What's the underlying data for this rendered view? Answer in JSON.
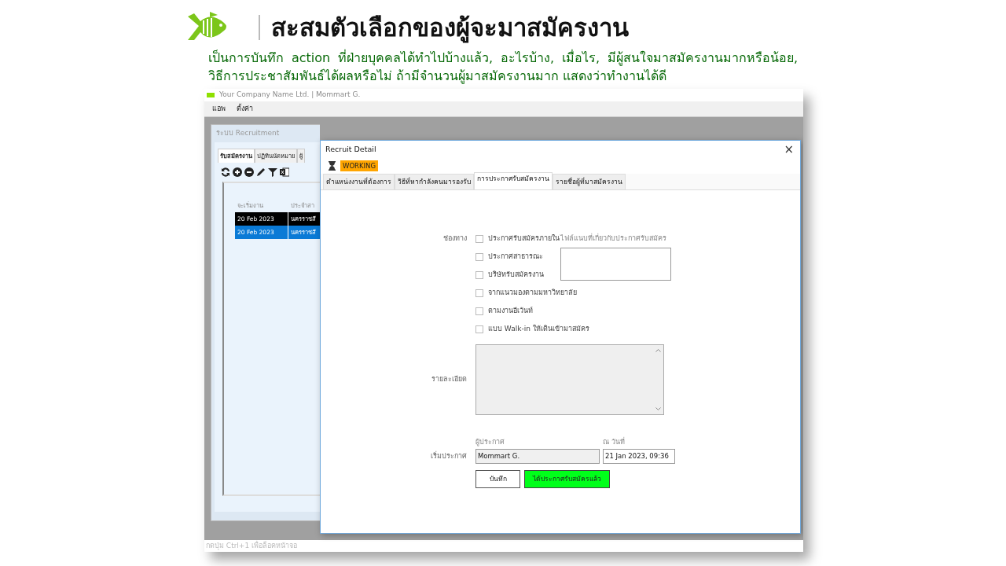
{
  "slide": {
    "title": "สะสมตัวเลือกของผู้จะมาสมัครงาน",
    "description": "เป็นการบันทึก action ที่ฝ่ายบุคคลได้ทำไปบ้างแล้ว, อะไรบ้าง, เมื่อไร, มีผู้สนใจมาสมัครงานมากหรือน้อย, วิธีการประชาสัมพันธ์ได้ผลหรือไม่ ถ้ามีจำนวนผู้มาสมัครงานมาก แสดงว่าทำงานได้ดี"
  },
  "app": {
    "window_title": "Your Company Name Ltd. | Mommart G.",
    "menu": [
      "แอพ",
      "ตั้งค่า"
    ],
    "status_bar": "กดปุ่ม Ctrl+1 เพื่อล็อคหน้าจอ"
  },
  "main_window": {
    "title": "ระบบ Recruitment",
    "tabs": [
      {
        "label": "รับสมัครงาน",
        "selected": true
      },
      {
        "label": "ปฏิทินนัดหมาย",
        "selected": false
      },
      {
        "label": "ผู้",
        "selected": false
      }
    ],
    "table": {
      "columns": [
        "จะเริ่มงาน",
        "ประจำสา"
      ],
      "rows": [
        {
          "cells": [
            "20 Feb 2023",
            "นครราชสี"
          ],
          "current": true,
          "selected": false
        },
        {
          "cells": [
            "20 Feb 2023",
            "นครราชสี"
          ],
          "current": false,
          "selected": true
        }
      ]
    }
  },
  "dialog": {
    "title": "Recruit Detail",
    "close": "×",
    "status": "WORKING",
    "tabs": [
      {
        "label": "ตำแหน่งงานที่ต้องการ",
        "selected": false
      },
      {
        "label": "วิธีที่หากำลังคนมารองรับ",
        "selected": false
      },
      {
        "label": "การประกาศรับสมัครงาน",
        "selected": true
      },
      {
        "label": "รายชื่อผู้ที่มาสมัครงาน",
        "selected": false
      }
    ],
    "channel_label": "ช่องทาง",
    "channels": [
      {
        "label": "ประกาศรับสมัครภายใน",
        "checked": false
      },
      {
        "label": "ประกาศสาธารณะ",
        "checked": false
      },
      {
        "label": "บริษัทรับสมัครงาน",
        "checked": false
      },
      {
        "label": "จากแนวมองตามมหาวิทยาลัย",
        "checked": false
      },
      {
        "label": "ตามงานอีเว้นท์",
        "checked": false
      },
      {
        "label": "แบบ Walk-in ให้เดินเข้ามาสมัคร",
        "checked": false
      }
    ],
    "attachment_label": "ไฟล์แนบที่เกี่ยวกับประกาศรับสมัคร",
    "details_label": "รายละเอียด",
    "publish_label": "เริ่มประกาศ",
    "publisher": {
      "label": "ผู้ประกาศ",
      "value": "Mommart G."
    },
    "date": {
      "label": "ณ วันที่",
      "value": "21 Jan 2023, 09:36"
    },
    "buttons": [
      {
        "label": "บันทึก",
        "kind": "default"
      },
      {
        "label": "ได้ประกาศรับสมัครแล้ว",
        "kind": "success"
      }
    ]
  }
}
